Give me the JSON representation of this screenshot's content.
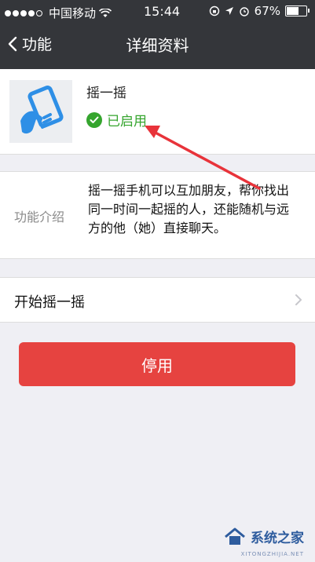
{
  "status_bar": {
    "carrier": "中国移动",
    "time": "15:44",
    "battery": "67%"
  },
  "nav": {
    "back_label": "功能",
    "title": "详细资料"
  },
  "feature": {
    "name": "摇一摇",
    "status": "已启用"
  },
  "intro": {
    "label": "功能介绍",
    "text": "摇一摇手机可以互加朋友，帮你找出同一时间一起摇的人，还能随机与远方的他（她）直接聊天。"
  },
  "actions": {
    "start_label": "开始摇一摇",
    "disable_label": "停用"
  },
  "watermark": {
    "text": "系统之家",
    "sub": "XITONGZHIJIA.NET"
  },
  "colors": {
    "nav_bg": "#34363a",
    "enabled_green": "#35a52e",
    "danger_red": "#e64340"
  }
}
